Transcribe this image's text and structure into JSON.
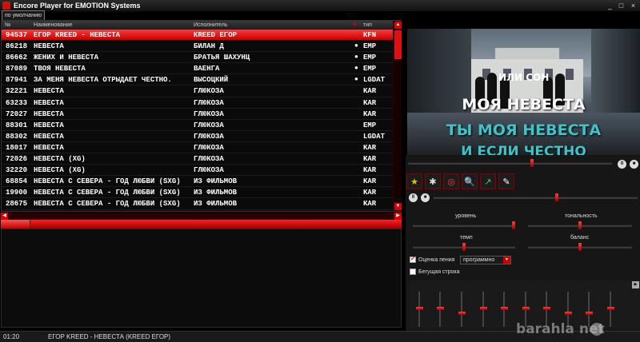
{
  "window": {
    "title": "Encore Player for EMOTION Systems",
    "minimize": "_",
    "maximize": "□",
    "close": "×"
  },
  "tab": {
    "label": "по умолчанию"
  },
  "playlist": {
    "columns": [
      "№",
      "Наименование",
      "Исполнитель",
      "тип"
    ],
    "sort_indicator": "▼",
    "rows": [
      {
        "num": "94537",
        "title": "ЕГОР KREED - НЕВЕСТА",
        "artist": "KREED ЕГОР",
        "dot": "",
        "type": "KFN",
        "selected": true
      },
      {
        "num": "86218",
        "title": "НЕВЕСТА",
        "artist": "БИЛАН Д",
        "dot": "●",
        "type": "EMP"
      },
      {
        "num": "86662",
        "title": "ЖЕНИХ И НЕВЕСТА",
        "artist": "БРАТЬЯ ШАХУНЦ",
        "dot": "●",
        "type": "EMP"
      },
      {
        "num": "87089",
        "title": "ТВОЯ НЕВЕСТА",
        "artist": "ВАЕНГА",
        "dot": "●",
        "type": "EMP"
      },
      {
        "num": "87941",
        "title": "ЗА МЕНЯ НЕВЕСТА ОТРЫДАЕТ ЧЕСТНО.",
        "artist": "ВЫСОЦКИЙ",
        "dot": "●",
        "type": "LGDAT"
      },
      {
        "num": "32221",
        "title": "НЕВЕСТА",
        "artist": "ГЛЮКОЗА",
        "dot": "",
        "type": "KAR"
      },
      {
        "num": "63233",
        "title": "НЕВЕСТА",
        "artist": "ГЛЮКОЗА",
        "dot": "",
        "type": "KAR"
      },
      {
        "num": "72027",
        "title": "НЕВЕСТА",
        "artist": "ГЛЮКОЗА",
        "dot": "",
        "type": "KAR"
      },
      {
        "num": "88301",
        "title": "НЕВЕСТА",
        "artist": "ГЛЮКОЗА",
        "dot": "",
        "type": "EMP"
      },
      {
        "num": "88302",
        "title": "НЕВЕСТА",
        "artist": "ГЛЮКОЗА",
        "dot": "",
        "type": "LGDAT"
      },
      {
        "num": "18017",
        "title": "НЕВЕСТА",
        "artist": "ГЛЮКОЗА",
        "dot": "",
        "type": "KAR"
      },
      {
        "num": "72026",
        "title": "НЕВЕСТА (XG)",
        "artist": "ГЛЮКОЗА",
        "dot": "",
        "type": "KAR"
      },
      {
        "num": "32220",
        "title": "НЕВЕСТА (XG)",
        "artist": "ГЛЮКОЗА",
        "dot": "",
        "type": "KAR"
      },
      {
        "num": "68854",
        "title": "НЕВЕСТА С СЕВЕРА - ГОД ЛЮБВИ (SXG)",
        "artist": "ИЗ ФИЛЬМОВ",
        "dot": "",
        "type": "KAR"
      },
      {
        "num": "19900",
        "title": "НЕВЕСТА С СЕВЕРА - ГОД ЛЮБВИ (SXG)",
        "artist": "ИЗ ФИЛЬМОВ",
        "dot": "",
        "type": "KAR"
      },
      {
        "num": "28675",
        "title": "НЕВЕСТА С СЕВЕРА - ГОД ЛЮБВИ (SXG)",
        "artist": "ИЗ ФИЛЬМОВ",
        "dot": "",
        "type": "KAR"
      }
    ]
  },
  "video": {
    "lyrics": [
      "ИЛИ СОН",
      "МОЯ НЕВЕСТА",
      "ТЫ МОЯ НЕВЕСТА",
      "И ЕСЛИ ЧЕСТНО"
    ]
  },
  "controls": {
    "pause_icon": "II",
    "stop_icon": "■",
    "fx_icons": [
      "★",
      "✱",
      "◎",
      "🔍",
      "↗",
      "✎"
    ],
    "level_label": "уровень",
    "key_label": "тональность",
    "tempo_label": "темп",
    "balance_label": "баланс",
    "rating_label": "Оценка пения",
    "rating_checked": true,
    "rating_mode": "программно",
    "ticker_label": "Бегущая строка",
    "ticker_checked": false
  },
  "status": {
    "time": "01:20",
    "now_playing": "ЕГОР KREED - НЕВЕСТА (KREED ЕГОР)"
  },
  "watermark": {
    "text": "barahla net"
  }
}
